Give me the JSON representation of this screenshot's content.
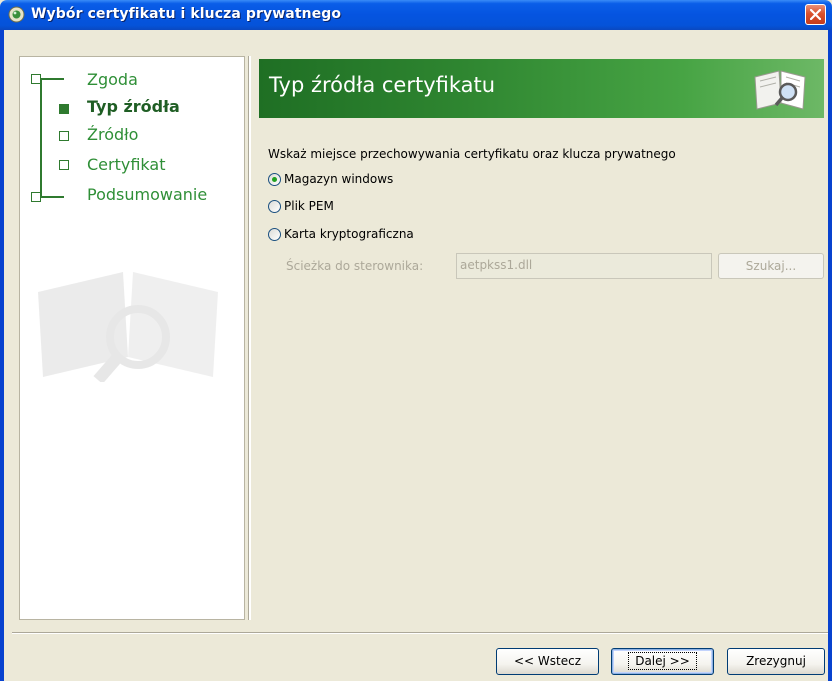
{
  "window": {
    "title": "Wybór certyfikatu i klucza prywatnego"
  },
  "sidebar": {
    "steps": [
      {
        "label": "Zgoda",
        "active": false
      },
      {
        "label": "Typ źródła",
        "active": true
      },
      {
        "label": "Źródło",
        "active": false
      },
      {
        "label": "Certyfikat",
        "active": false
      },
      {
        "label": "Podsumowanie",
        "active": false
      }
    ]
  },
  "header": {
    "title": "Typ źródła certyfikatu"
  },
  "main": {
    "instruction": "Wskaż miejsce przechowywania certyfikatu oraz klucza prywatnego",
    "options": [
      {
        "label": "Magazyn windows",
        "checked": true
      },
      {
        "label": "Plik PEM",
        "checked": false
      },
      {
        "label": "Karta kryptograficzna",
        "checked": false
      }
    ],
    "driver_path_label": "Ścieżka do sterownika:",
    "driver_path_value": "aetpkss1.dll",
    "browse_label": "Szukaj..."
  },
  "footer": {
    "back_label": "<< Wstecz",
    "next_label": "Dalej >>",
    "cancel_label": "Zrezygnuj"
  },
  "colors": {
    "titlebar": "#0554e0",
    "accent_green": "#2f8f37",
    "header_green": "#2e8530"
  },
  "icons": {
    "title": "certificate-app-icon",
    "close": "close-icon",
    "header": "book-magnifier-icon"
  }
}
